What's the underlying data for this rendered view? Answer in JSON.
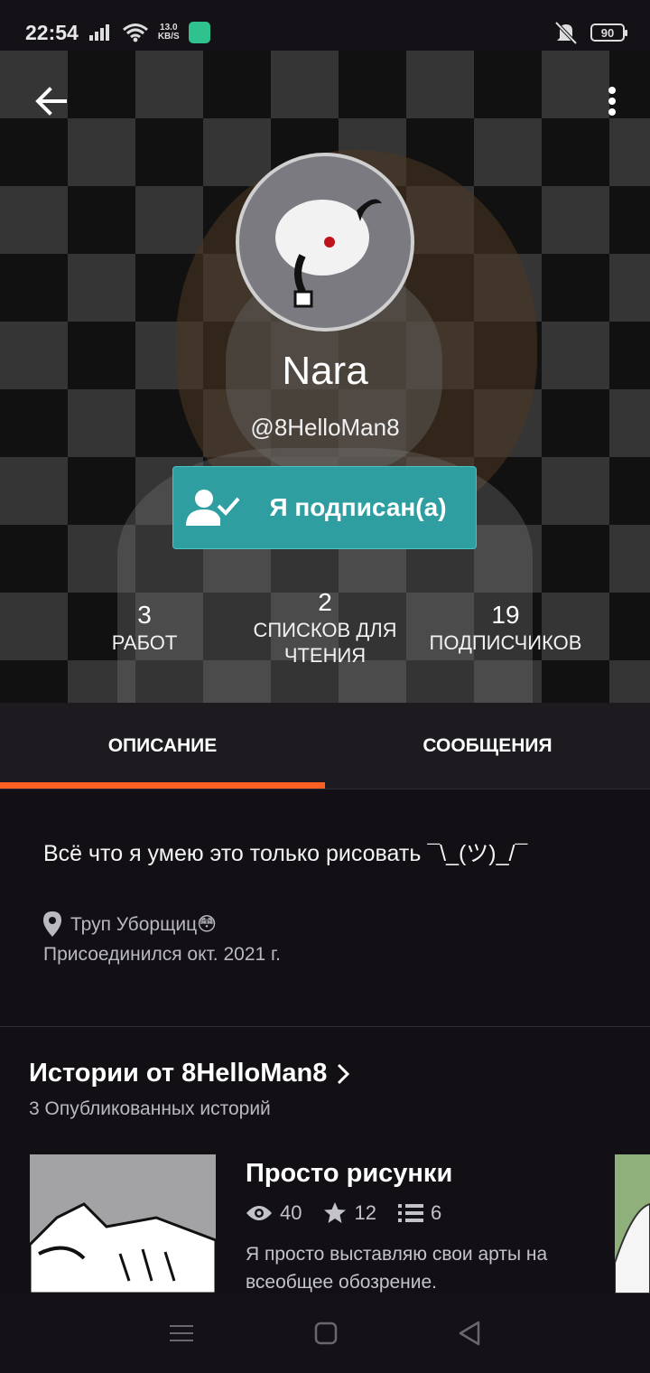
{
  "status_bar": {
    "time": "22:54",
    "speed_value": "13.0",
    "speed_unit": "KB/S",
    "battery": "90"
  },
  "profile": {
    "display_name": "Nara",
    "username": "@8HelloMan8",
    "follow_label": "Я подписан(а)",
    "stats": [
      {
        "value": "3",
        "label": "РАБОТ"
      },
      {
        "value": "2",
        "label": "СПИСКОВ ДЛЯ ЧТЕНИЯ"
      },
      {
        "value": "19",
        "label": "ПОДПИСЧИКОВ"
      }
    ]
  },
  "tabs": [
    {
      "label": "ОПИСАНИЕ",
      "active": true
    },
    {
      "label": "СООБЩЕНИЯ",
      "active": false
    }
  ],
  "about": {
    "text": "Всё что я умею это только рисовать ¯\\_(ツ)_/¯",
    "location": "Труп Уборщиц😳",
    "joined": "Присоединился окт. 2021 г."
  },
  "stories": {
    "title": "Истории от 8HelloMan8",
    "subtitle": "3 Опубликованных историй",
    "items": [
      {
        "title": "Просто рисунки",
        "views": "40",
        "votes": "12",
        "parts": "6",
        "description": "Я просто выставляю свои арты на всеобщее обозрение."
      }
    ]
  },
  "colors": {
    "accent": "#ff6122",
    "follow_button": "#2e9ea0",
    "background": "#121015"
  },
  "icons": [
    "signal-icon",
    "wifi-icon",
    "mute-icon",
    "back-arrow-icon",
    "overflow-menu-icon",
    "user-check-icon",
    "location-pin-icon",
    "chevron-right-icon",
    "eye-icon",
    "star-icon",
    "list-icon"
  ]
}
